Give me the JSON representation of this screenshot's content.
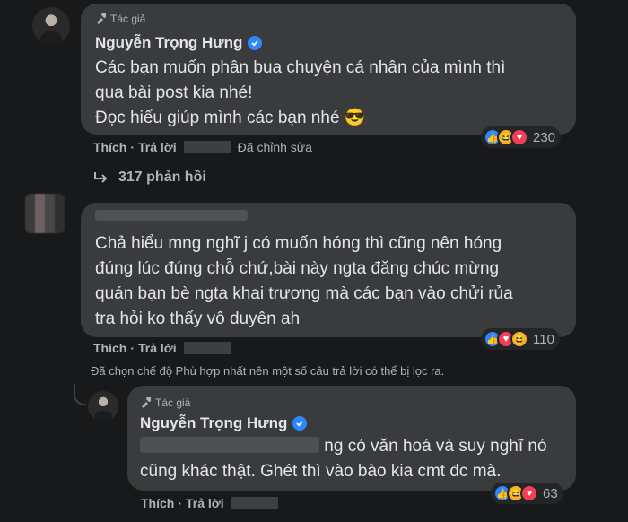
{
  "comments": [
    {
      "badge": "Tác giả",
      "author": "Nguyễn Trọng Hưng",
      "lines": [
        "Các bạn muốn phân bua chuyện cá nhân của mình thì",
        "qua bài post kia nhé!",
        "Đọc hiểu giúp mình các bạn nhé 😎"
      ],
      "like_label": "Thích",
      "reply_label": "Trả lời",
      "edited_label": "Đã chỉnh sửa",
      "reaction_count": "230",
      "reaction_icons": [
        "like-icon",
        "haha-icon",
        "love-icon"
      ]
    },
    {
      "lines": [
        "Chả hiểu mng nghĩ j có muốn hóng thì cũng nên hóng",
        "đúng lúc đúng chỗ chứ,bài này ngta đăng chúc mừng",
        "quán bạn bè ngta khai trương mà các bạn vào chửi rủa",
        "tra hỏi ko thấy vô duyên ah"
      ],
      "like_label": "Thích",
      "reply_label": "Trả lời",
      "reaction_count": "110",
      "reaction_icons": [
        "like-icon",
        "love-icon",
        "haha-icon"
      ]
    },
    {
      "badge": "Tác giả",
      "author": "Nguyễn Trọng Hưng",
      "lines": [
        "ng có văn hoá và suy nghĩ nó",
        "cũng khác thật. Ghét thì vào bào kia cmt đc mà."
      ],
      "like_label": "Thích",
      "reply_label": "Trả lời",
      "reaction_count": "63",
      "reaction_icons": [
        "like-icon",
        "haha-icon",
        "love-icon"
      ]
    }
  ],
  "replies_link": "317 phản hồi",
  "filter_note": "Đã chọn chế độ Phù hợp nhất nên một số câu trả lời có thể bị lọc ra.",
  "colors": {
    "background": "#18191a",
    "bubble": "#3a3b3c",
    "text": "#e4e6eb",
    "secondary": "#b0b3b8",
    "verified": "#2d88ff"
  }
}
